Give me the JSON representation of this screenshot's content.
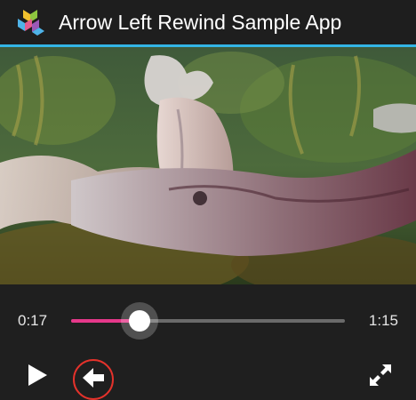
{
  "app": {
    "title": "Arrow Left Rewind Sample App",
    "icon": "app-logo-icon",
    "accent_color": "#33b5e5"
  },
  "video": {
    "content": "video-frame"
  },
  "player": {
    "current_time": "0:17",
    "total_time": "1:15",
    "progress_fraction": 0.25,
    "progress_color": "#e6388a",
    "buttons": {
      "play_icon": "play-icon",
      "rewind_icon": "arrow-left-icon",
      "rewind_highlight_color": "#e4322b",
      "fullscreen_icon": "fullscreen-icon"
    }
  }
}
